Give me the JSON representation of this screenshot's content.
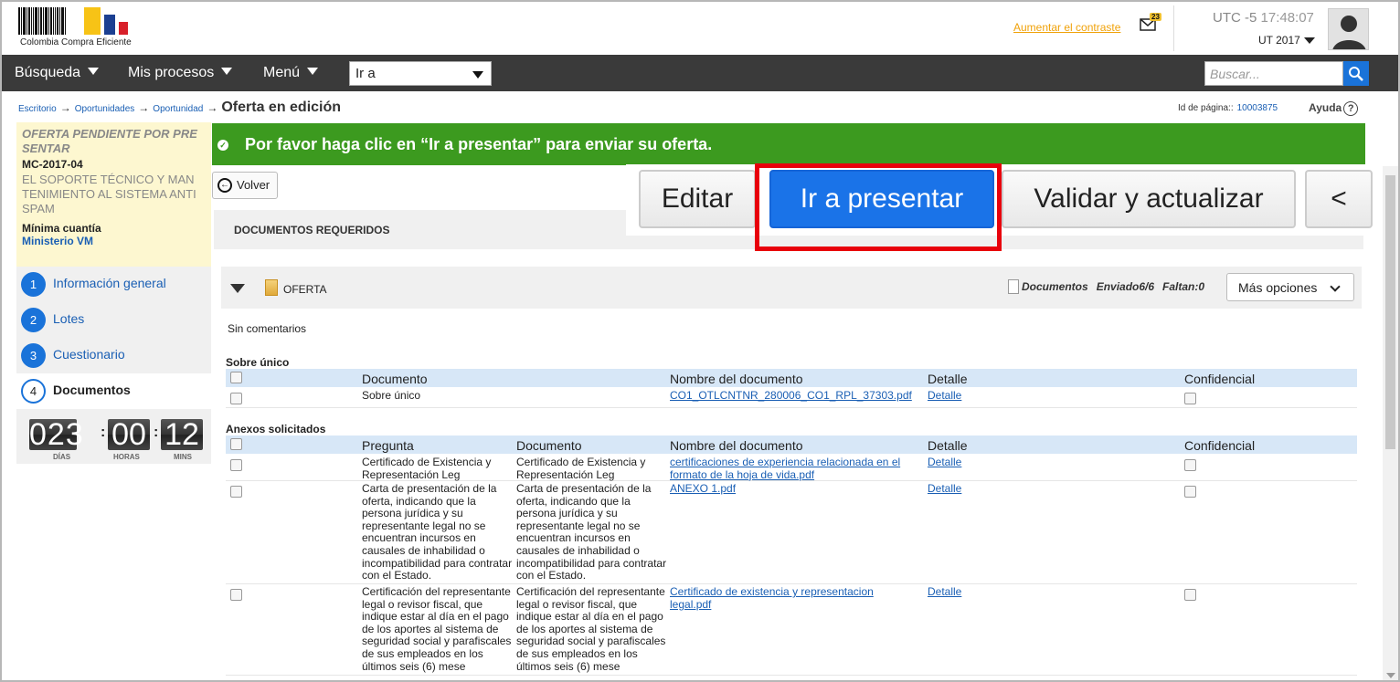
{
  "header": {
    "logo_text": "Colombia Compra Eficiente",
    "contrast_link": "Aumentar el contraste",
    "mail_count": "23",
    "timezone": "UTC -5",
    "time": "17:48:07",
    "user": "UT 2017"
  },
  "nav": {
    "items": [
      "Búsqueda",
      "Mis procesos",
      "Menú"
    ],
    "goto_value": "Ir a",
    "search_placeholder": "Buscar..."
  },
  "breadcrumb": {
    "items": [
      "Escritorio",
      "Oportunidades",
      "Oportunidad"
    ],
    "current": "Oferta en edición"
  },
  "page_id": {
    "label": "Id de página::",
    "value": "10003875"
  },
  "help_label": "Ayuda",
  "left_panel": {
    "status": "OFERTA PENDIENTE POR PRE SENTAR",
    "reference": "MC-2017-04",
    "description": "EL SOPORTE TÉCNICO Y MAN TENIMIENTO AL SISTEMA ANTI SPAM",
    "type": "Mínima cuantía",
    "entity": "Ministerio VM"
  },
  "steps": [
    {
      "num": "1",
      "label": "Información general"
    },
    {
      "num": "2",
      "label": "Lotes"
    },
    {
      "num": "3",
      "label": "Cuestionario"
    },
    {
      "num": "4",
      "label": "Documentos"
    }
  ],
  "countdown": {
    "days": "023",
    "hours": "00",
    "mins": "12",
    "days_label": "DÍAS",
    "hours_label": "HORAS",
    "mins_label": "MINS"
  },
  "banner": {
    "message": "Por favor haga clic en “Ir a presentar” para enviar su oferta."
  },
  "volver_label": "Volver",
  "actions": {
    "edit": "Editar",
    "submit": "Ir a presentar",
    "validate": "Validar y actualizar",
    "collapse": "<"
  },
  "docs_required_title": "DOCUMENTOS REQUERIDOS",
  "folder": {
    "title": "OFERTA",
    "documents_label": "Documentos",
    "sent_label": "Enviado6/6",
    "missing_label": "Faltan:0",
    "more_options": "Más opciones"
  },
  "comments": "Sin comentarios",
  "sobre_unico": {
    "title": "Sobre único",
    "headers": [
      "Documento",
      "Nombre del documento",
      "Detalle",
      "Confidencial"
    ],
    "rows": [
      {
        "documento": "Sobre único",
        "nombre": "CO1_OTLCNTNR_280006_CO1_RPL_37303.pdf",
        "detalle": "Detalle"
      }
    ]
  },
  "anexos": {
    "title": "Anexos solicitados",
    "headers": [
      "Pregunta",
      "Documento",
      "Nombre del documento",
      "Detalle",
      "Confidencial"
    ],
    "rows": [
      {
        "pregunta": "Certificado de Existencia y Representación Leg",
        "documento": "Certificado de Existencia y Representación Leg",
        "nombre": "certificaciones de experiencia relacionada en el formato de la hoja de vida.pdf",
        "detalle": "Detalle"
      },
      {
        "pregunta": "Carta de presentación de la oferta, indicando que la persona jurídica y su representante legal no se encuentran incursos en causales de inhabilidad o incompatibilidad para contratar con el Estado.",
        "documento": "Carta de presentación de la oferta, indicando que la persona jurídica y su representante legal no se encuentran incursos en causales de inhabilidad o incompatibilidad para contratar con el Estado.",
        "nombre": "ANEXO 1.pdf",
        "detalle": "Detalle"
      },
      {
        "pregunta": "Certificación del representante legal o revisor fiscal, que indique estar al día en el pago de los aportes al sistema de seguridad social y parafiscales de sus empleados en los últimos seis (6) mese",
        "documento": "Certificación del representante legal o revisor fiscal, que indique estar al día en el pago de los aportes al sistema de seguridad social y parafiscales de sus empleados en los últimos seis (6) mese",
        "nombre": "Certificado de existencia y representacion legal.pdf",
        "detalle": "Detalle"
      }
    ]
  },
  "colors": {
    "nav_bg": "#3a3a3a",
    "banner_green": "#3c9a1f",
    "primary_blue": "#1a73e8",
    "highlight_red": "#e8000c",
    "panel_yellow": "#fdf7d0"
  }
}
